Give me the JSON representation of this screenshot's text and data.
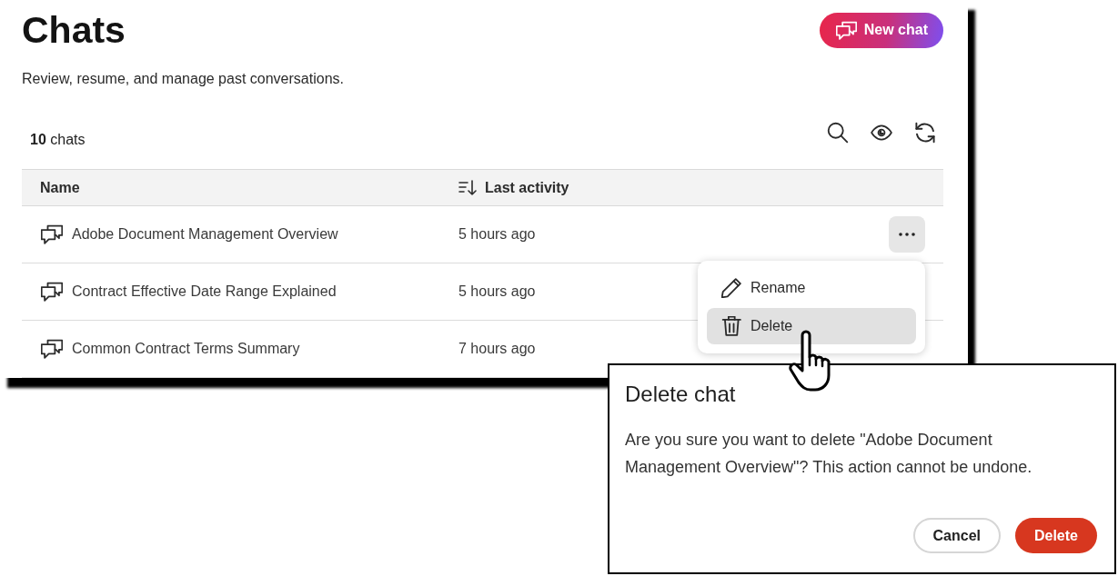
{
  "header": {
    "title": "Chats",
    "subtitle": "Review, resume, and manage past conversations.",
    "new_chat_button": "New chat"
  },
  "list": {
    "count": "**10** chats",
    "columns": [
      {
        "label": "Name",
        "sorted": false
      },
      {
        "label": "Last activity",
        "sorted": true
      }
    ],
    "rows": [
      {
        "name": "Adobe Document Management Overview",
        "last_activity": "5 hours ago",
        "menu_open": true
      },
      {
        "name": "Contract Effective Date Range Explained",
        "last_activity": "5 hours ago",
        "menu_open": false
      },
      {
        "name": "Common Contract Terms Summary",
        "last_activity": "7 hours ago",
        "menu_open": false
      }
    ]
  },
  "row_menu": {
    "items": [
      {
        "label": "Rename",
        "kind": "rename",
        "highlighted": false
      },
      {
        "label": "Delete",
        "kind": "delete",
        "highlighted": true
      }
    ]
  },
  "dialog": {
    "title": "Delete chat",
    "message": "Are you sure you want to delete \"Adobe Document Management Overview\"? This action cannot be undone.",
    "buttons": [
      {
        "label": "Cancel",
        "kind": "secondary"
      },
      {
        "label": "Delete",
        "kind": "primary"
      }
    ]
  }
}
